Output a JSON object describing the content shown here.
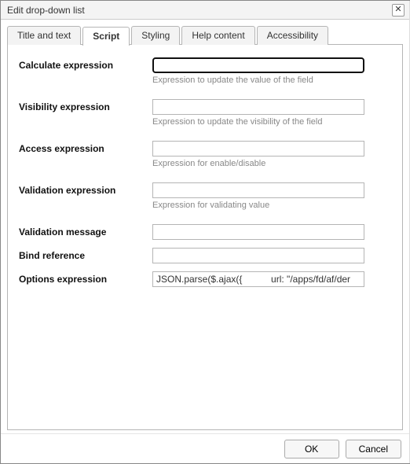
{
  "dialog": {
    "title": "Edit drop-down list",
    "close_glyph": "✕"
  },
  "tabs": [
    {
      "label": "Title and text",
      "active": false
    },
    {
      "label": "Script",
      "active": true
    },
    {
      "label": "Styling",
      "active": false
    },
    {
      "label": "Help content",
      "active": false
    },
    {
      "label": "Accessibility",
      "active": false
    }
  ],
  "fields": {
    "calculate": {
      "label": "Calculate expression",
      "value": "",
      "hint": "Expression to update the value of the field"
    },
    "visibility": {
      "label": "Visibility expression",
      "value": "",
      "hint": "Expression to update the visibility of the field"
    },
    "access": {
      "label": "Access expression",
      "value": "",
      "hint": "Expression for enable/disable"
    },
    "validation": {
      "label": "Validation expression",
      "value": "",
      "hint": "Expression for validating value"
    },
    "validation_message": {
      "label": "Validation message",
      "value": ""
    },
    "bind_reference": {
      "label": "Bind reference",
      "value": ""
    },
    "options": {
      "label": "Options expression",
      "value": "JSON.parse($.ajax({           url: \"/apps/fd/af/der"
    }
  },
  "buttons": {
    "ok": "OK",
    "cancel": "Cancel"
  }
}
